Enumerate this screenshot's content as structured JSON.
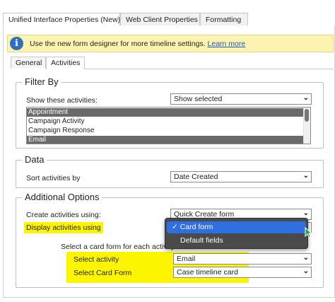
{
  "top_tabs": [
    {
      "label": "Unified Interface Properties (New)"
    },
    {
      "label": "Web Client Properties"
    },
    {
      "label": "Formatting"
    }
  ],
  "info_bar": {
    "text": "Use the new form designer for more timeline settings.",
    "link": "Learn more"
  },
  "inner_tabs": [
    {
      "label": "General"
    },
    {
      "label": "Activities"
    }
  ],
  "filter_by": {
    "legend": "Filter By",
    "show_label": "Show these activities:",
    "show_value": "Show selected",
    "activities": [
      "Appointment",
      "Campaign Activity",
      "Campaign Response",
      "Email"
    ]
  },
  "data_group": {
    "legend": "Data",
    "sort_label": "Sort activities by",
    "sort_value": "Date Created"
  },
  "additional_options": {
    "legend": "Additional Options",
    "create_label": "Create activities using:",
    "create_value": "Quick Create form",
    "display_label": "Display activities using",
    "card_form_prompt": "Select a card form for each activity",
    "select_activity_label": "Select activity",
    "select_activity_value": "Email",
    "select_card_form_label": "Select Card Form",
    "select_card_form_value": "Case timeline card"
  },
  "display_dropdown": {
    "options": [
      "Card form",
      "Default fields"
    ],
    "selected_mark": "✓"
  },
  "colors": {
    "highlight": "#fdf500",
    "info_bg": "#fdf3b0",
    "selection": "#2f6fe0"
  }
}
